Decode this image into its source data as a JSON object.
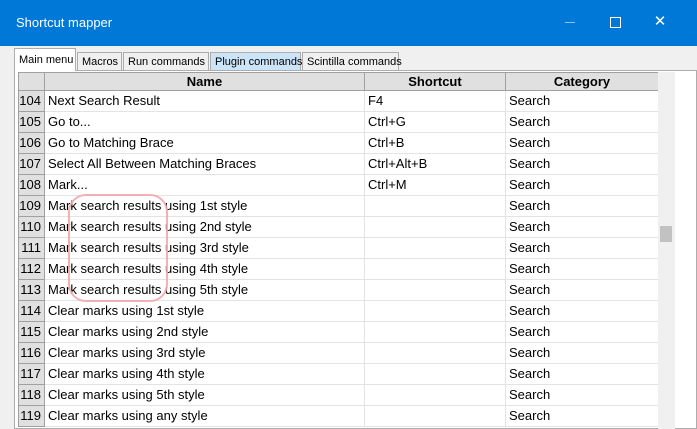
{
  "window": {
    "title": "Shortcut mapper"
  },
  "tabs": [
    {
      "label": "Main menu"
    },
    {
      "label": "Macros"
    },
    {
      "label": "Run commands"
    },
    {
      "label": "Plugin commands"
    },
    {
      "label": "Scintilla commands"
    }
  ],
  "table": {
    "headers": {
      "name": "Name",
      "shortcut": "Shortcut",
      "category": "Category"
    },
    "rows": [
      {
        "idx": "104",
        "name": "Next Search Result",
        "shortcut": "F4",
        "category": "Search"
      },
      {
        "idx": "105",
        "name": "Go to...",
        "shortcut": "Ctrl+G",
        "category": "Search"
      },
      {
        "idx": "106",
        "name": "Go to Matching Brace",
        "shortcut": "Ctrl+B",
        "category": "Search"
      },
      {
        "idx": "107",
        "name": "Select All Between Matching Braces",
        "shortcut": "Ctrl+Alt+B",
        "category": "Search"
      },
      {
        "idx": "108",
        "name": "Mark...",
        "shortcut": "Ctrl+M",
        "category": "Search"
      },
      {
        "idx": "109",
        "name": "Mark search results using 1st style",
        "shortcut": "",
        "category": "Search"
      },
      {
        "idx": "110",
        "name": "Mark search results using 2nd style",
        "shortcut": "",
        "category": "Search"
      },
      {
        "idx": "111",
        "name": "Mark search results using 3rd style",
        "shortcut": "",
        "category": "Search"
      },
      {
        "idx": "112",
        "name": "Mark search results using 4th style",
        "shortcut": "",
        "category": "Search"
      },
      {
        "idx": "113",
        "name": "Mark search results using 5th style",
        "shortcut": "",
        "category": "Search"
      },
      {
        "idx": "114",
        "name": "Clear marks using 1st style",
        "shortcut": "",
        "category": "Search"
      },
      {
        "idx": "115",
        "name": "Clear marks using 2nd style",
        "shortcut": "",
        "category": "Search"
      },
      {
        "idx": "116",
        "name": "Clear marks using 3rd style",
        "shortcut": "",
        "category": "Search"
      },
      {
        "idx": "117",
        "name": "Clear marks using 4th style",
        "shortcut": "",
        "category": "Search"
      },
      {
        "idx": "118",
        "name": "Clear marks using 5th style",
        "shortcut": "",
        "category": "Search"
      },
      {
        "idx": "119",
        "name": "Clear marks using any style",
        "shortcut": "",
        "category": "Search"
      }
    ]
  },
  "colors": {
    "titlebar": "#0078d7",
    "highlight": "#f2a8ad",
    "plugin_tab": "#cce4f7"
  }
}
